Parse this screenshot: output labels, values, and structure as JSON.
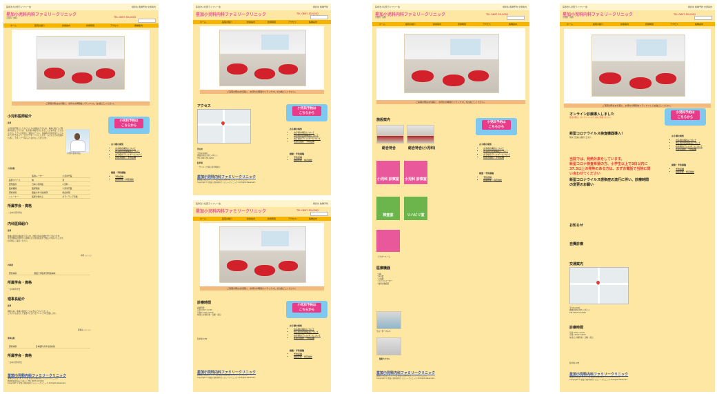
{
  "header": {
    "tagline": "医療法人社団ライフリー会",
    "top_links": [
      "検診先",
      "各種予約",
      "交通案内"
    ],
    "logo": "星加小児科内科ファミリークリニック",
    "tel": "TEL 0897-55-0002",
    "area": "小児科・内科"
  },
  "nav": [
    "ホーム",
    "医院の紹介",
    "診療案内",
    "診療時間",
    "アクセス",
    "各種案内"
  ],
  "hero_note": "ご来院の際はお気軽に、お待ちの時間をリラックスしてお過ごしください。",
  "cta": {
    "line1": "小児科予約は",
    "line2": "こちらから"
  },
  "sidebar": {
    "heading1": "お子様の病気",
    "items1": [
      "お子様の病気について",
      "お子様の皮膚病変について",
      "お子様のアレルギーについて",
      "乳幼児健診・予防接種"
    ],
    "heading2": "検査・予防接種",
    "items2": [
      "予防接種",
      "健康診断・特定健診"
    ]
  },
  "footer": {
    "back": "ページのトップへ戻る",
    "logo": "星加小児科内科ファミリークリニック",
    "lines": [
      "医療法人社団ライフリー会 星加小児科内科ファミリークリニック",
      "愛媛県新居浜市○○町○○ TEL 0897-55-0002",
      "Copyright © 星加小児科内科ファミリークリニック All Rights Reserved."
    ]
  },
  "p1": {
    "title": "小児科医師紹介",
    "sub_greeting": "挨拶",
    "greeting": [
      "小児科専門医として子どもたちの健康を守るため、地域に根ざした医療を提供しています。",
      "お子様の体調で気になることがあれば、どんな小さなことでもお気軽にご相談ください。",
      "保護者の皆様が安心して子育てができるよう、全力でサポートいたします。",
      "子どもたちの笑顔のために、スタッフ一同心よりお待ちしております。"
    ],
    "portrait_caption": "小児科 医師 院長",
    "sub_history": "小児科歴",
    "history_rows": [
      [
        "",
        "医療レーザー",
        "小児専門医"
      ],
      [
        "医師スペース",
        "無",
        "有"
      ],
      [
        "愛知医科",
        "日本小児科医",
        "小児科"
      ],
      [
        "医療機関",
        "医師関連",
        "小児専門医"
      ],
      [
        "研修病院",
        "愛媛大学 付属病院",
        "総合病院"
      ],
      [
        "トレーナー",
        "医師の質向上",
        "ボランティア活動"
      ]
    ],
    "title_qual": "所属学会・資格",
    "qual_text": "・日本小児科学会",
    "title_internal": "内科医師紹介",
    "sub_greeting2": "挨拶",
    "greeting2": [
      "地域の皆様の健康を守るため、内科全般の診療を行っております。",
      "生活習慣病の管理から風邪などの急性疾患まで幅広く対応いたします。",
      "お気軽にご来院ください。"
    ],
    "sign2": "内科 ○○ ○○",
    "sub_history2": "内科歴",
    "history2": [
      "研修病院",
      "愛媛大学医学部附属病院"
    ],
    "title_qual2": "所属学会・資格",
    "qual2": "・日本内科学会",
    "title_director": "理事長紹介",
    "sub_greeting3": "挨拶",
    "greeting3": [
      "開院以来、地域の皆様とともに歩んでまいりました。",
      "これからも安心して受診いただけるクリニックを目指します。"
    ],
    "sign3": "理事長 ○○ ○○",
    "sub_history3": "理事長歴",
    "history3": [
      "研修病院",
      "日本医科大学付属病院"
    ],
    "title_qual3": "所属学会・資格",
    "qual3": "・日本小児科学会"
  },
  "p2": {
    "title": "アクセス",
    "addr_h": "所在地",
    "addr": [
      "〒792-0000",
      "愛媛県新居浜市○○町○○",
      "TEL 0897-55-0002"
    ],
    "parking_h": "駐車場",
    "parking": "・クリニック前に駐車場あり"
  },
  "p3": {
    "title": "診療時間",
    "lines": [
      "診療時間",
      "午前 9:00〜12:00",
      "午後 14:00〜18:00",
      "休診日 木曜午後・日曜・祝日"
    ],
    "extra": "駐車場 20台"
  },
  "p4": {
    "title": "施設案内",
    "labels": [
      "総合待合",
      "総合待合(小児科)"
    ],
    "signs": [
      "小児科 診察室",
      "小児科 診察室",
      "検査室",
      "リハビリ室",
      "パウダールーム"
    ],
    "equip_title": "医療機器",
    "equip": [
      "・X線",
      "・超音波",
      "・心電図",
      "・スパイロメーター",
      "・血球計数装置"
    ],
    "bed_label": "ウォーターベッド",
    "capsule_label": "酸素カプセル"
  },
  "p5": {
    "t1": "オンライン診療導入しました",
    "t1_sub": "受診の際は、オンラインシステムをご利用ください。",
    "t2": "新型コロナウイルス検査機器導入！",
    "t2_sub": "院内で迅速に検査できます。",
    "t3_red": "当院では、発熱外来をしています。",
    "t3_red2": "新型コロナ検査希望の方、小学生以上で3日以内に",
    "t3_red3": "37.5以上の発熱のある方は、まずお電話で当院に問",
    "t3_red4": "い合わせてください",
    "t4": "新型コロナウイルス感染症の流行に伴い、診療時間",
    "t4b": "の変更のお願い",
    "notice": "お知らせ",
    "vaccine": "自費診療",
    "access": "交通案内",
    "hours": "診療時間"
  }
}
